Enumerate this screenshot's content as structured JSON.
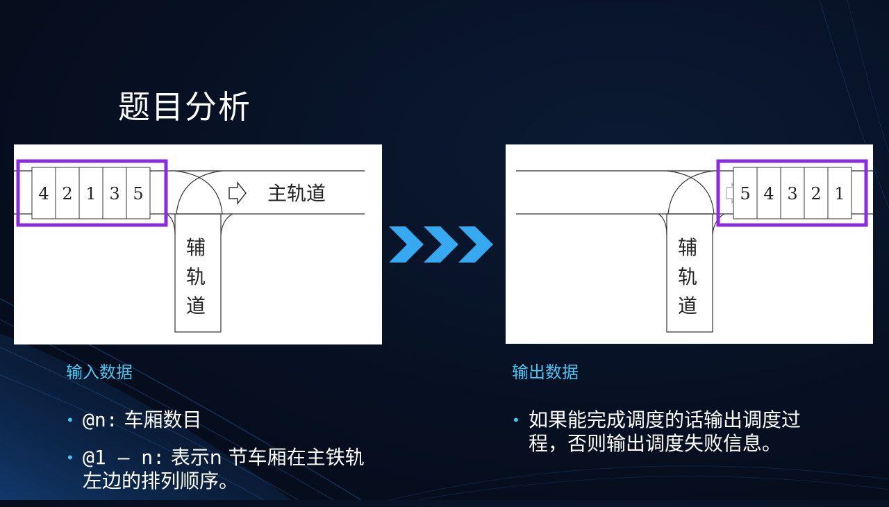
{
  "slide": {
    "title": "题目分析"
  },
  "left_diagram": {
    "cars": [
      "4",
      "2",
      "1",
      "3",
      "5"
    ],
    "main_track_label": "主轨道",
    "side_track_label": [
      "辅",
      "轨",
      "道"
    ],
    "highlight_color": "#8a2be2"
  },
  "right_diagram": {
    "cars": [
      "5",
      "4",
      "3",
      "2",
      "1"
    ],
    "side_track_label": [
      "辅",
      "轨",
      "道"
    ],
    "highlight_color": "#8a2be2"
  },
  "arrows": {
    "icon": "triple-chevron-right-icon",
    "color": "#36a9f0"
  },
  "input": {
    "heading": "输入数据",
    "bullets": [
      {
        "code": "@n:",
        "text": " 车厢数目"
      },
      {
        "code": "@1 – n:",
        "text": " 表示n 节车厢在主铁轨左边的排列顺序。"
      }
    ]
  },
  "output": {
    "heading": "输出数据",
    "bullets": [
      {
        "text": "如果能完成调度的话输出调度过程，否则输出调度失败信息。"
      }
    ]
  }
}
